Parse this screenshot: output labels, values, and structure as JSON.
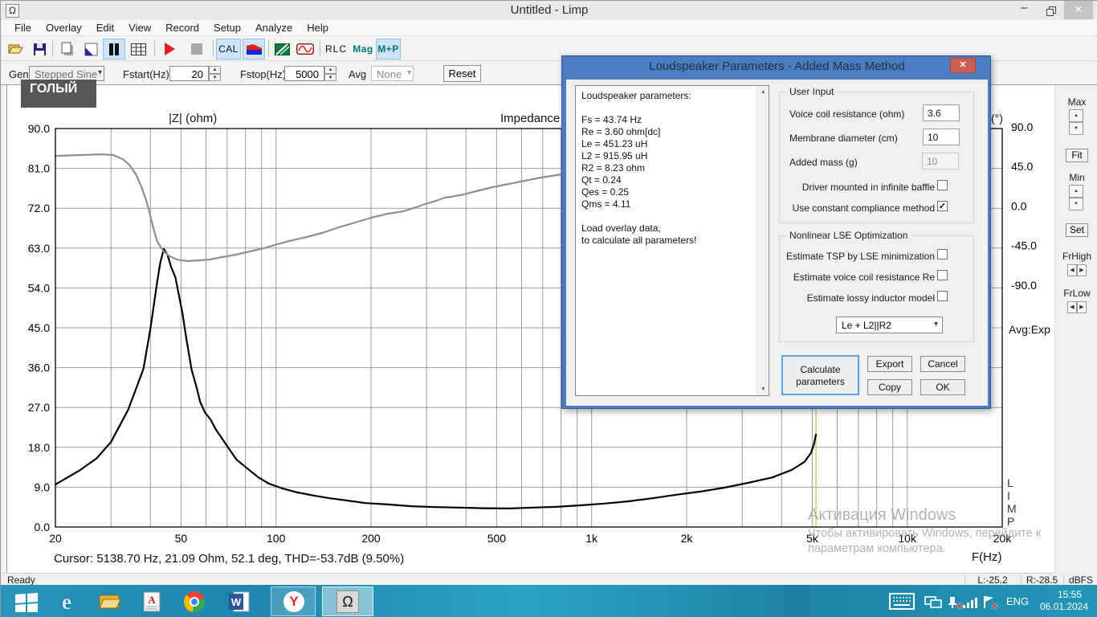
{
  "window": {
    "title": "Untitled - Limp",
    "icon": "Ω"
  },
  "menu": {
    "items": [
      "File",
      "Overlay",
      "Edit",
      "View",
      "Record",
      "Setup",
      "Analyze",
      "Help"
    ]
  },
  "toolbar": {
    "cal": "CAL",
    "rlc": "RLC",
    "mag": "Mag",
    "mp": "M+P"
  },
  "controls": {
    "gen_label": "Gen",
    "gen_value": "Stepped Sine",
    "fstart_label": "Fstart(Hz)",
    "fstart_value": "20",
    "fstop_label": "Fstop(Hz)",
    "fstop_value": "5000",
    "avg_label": "Avg",
    "avg_value": "None",
    "reset": "Reset"
  },
  "tooltip": {
    "text": "ГОЛЫЙ"
  },
  "side_panel": {
    "max": "Max",
    "fit": "Fit",
    "min": "Min",
    "set": "Set",
    "frhigh": "FrHigh",
    "frlow": "FrLow"
  },
  "chart_data": {
    "type": "line",
    "title": "Impedance",
    "y_left_label": "|Z| (ohm)",
    "y_right_label": "(°)",
    "x_label": "F(Hz)",
    "x_scale": "log",
    "x_range": [
      20,
      20000
    ],
    "y_left_range": [
      0,
      90
    ],
    "y_left_ticks": [
      "90.0",
      "81.0",
      "72.0",
      "63.0",
      "54.0",
      "45.0",
      "36.0",
      "27.0",
      "18.0",
      "9.0",
      "0.0"
    ],
    "x_ticks": [
      {
        "f": 20,
        "label": "20"
      },
      {
        "f": 50,
        "label": "50"
      },
      {
        "f": 100,
        "label": "100"
      },
      {
        "f": 200,
        "label": "200"
      },
      {
        "f": 500,
        "label": "500"
      },
      {
        "f": 1000,
        "label": "1k"
      },
      {
        "f": 2000,
        "label": "2k"
      },
      {
        "f": 5000,
        "label": "5k"
      },
      {
        "f": 10000,
        "label": "10k"
      },
      {
        "f": 20000,
        "label": "20k"
      }
    ],
    "grid_freqs": [
      30,
      40,
      50,
      60,
      70,
      80,
      90,
      100,
      200,
      300,
      400,
      500,
      600,
      700,
      800,
      900,
      1000,
      2000,
      3000,
      4000,
      5000,
      6000,
      7000,
      8000,
      9000,
      10000
    ],
    "y_right_ticks": [
      {
        "deg": 90,
        "label": "90.0"
      },
      {
        "deg": 45,
        "label": "45.0"
      },
      {
        "deg": 0,
        "label": "0.0"
      },
      {
        "deg": -45,
        "label": "-45.0"
      },
      {
        "deg": -90,
        "label": "-90.0"
      }
    ],
    "logo_letters": [
      "L",
      "I",
      "M",
      "P"
    ],
    "avg_mode": "Avg:Exp",
    "cursor_hz": 5138.7,
    "cursor_text": "Cursor: 5138.70 Hz, 21.09 Ohm, 52.1 deg, THD=-53.7dB (9.50%)",
    "series": [
      {
        "name": "impedance_magnitude_ohm",
        "color": "#000000",
        "axis": "left",
        "points": [
          [
            20,
            9.6
          ],
          [
            24,
            12.9
          ],
          [
            27,
            15.5
          ],
          [
            30,
            19.2
          ],
          [
            34,
            26.5
          ],
          [
            38,
            35.7
          ],
          [
            40,
            44.8
          ],
          [
            42,
            55.2
          ],
          [
            43,
            59.7
          ],
          [
            44.1,
            62.8
          ],
          [
            45.3,
            61.5
          ],
          [
            46.5,
            58.8
          ],
          [
            48,
            56.4
          ],
          [
            50.5,
            48.4
          ],
          [
            52,
            42.5
          ],
          [
            54,
            35.6
          ],
          [
            56,
            31.6
          ],
          [
            57.5,
            28.3
          ],
          [
            59.5,
            25.9
          ],
          [
            62,
            24.3
          ],
          [
            64.5,
            22.0
          ],
          [
            70,
            18.3
          ],
          [
            75,
            15.2
          ],
          [
            81.5,
            13.1
          ],
          [
            88,
            11.2
          ],
          [
            95,
            9.8
          ],
          [
            105,
            8.7
          ],
          [
            117,
            7.8
          ],
          [
            132,
            7.1
          ],
          [
            148,
            6.5
          ],
          [
            167,
            6.0
          ],
          [
            192,
            5.4
          ],
          [
            226,
            5.1
          ],
          [
            268,
            4.7
          ],
          [
            321,
            4.5
          ],
          [
            382,
            4.4
          ],
          [
            455,
            4.25
          ],
          [
            546,
            4.2
          ],
          [
            650,
            4.4
          ],
          [
            774,
            4.55
          ],
          [
            922,
            4.9
          ],
          [
            1098,
            5.3
          ],
          [
            1308,
            5.8
          ],
          [
            1558,
            6.5
          ],
          [
            1856,
            7.3
          ],
          [
            2210,
            8.0
          ],
          [
            2633,
            8.9
          ],
          [
            3136,
            10.0
          ],
          [
            3735,
            11.2
          ],
          [
            4307,
            12.9
          ],
          [
            4720,
            14.7
          ],
          [
            4950,
            16.7
          ],
          [
            5060,
            18.6
          ],
          [
            5139,
            20.9
          ]
        ]
      },
      {
        "name": "phase_deg",
        "color": "#8f8f8f",
        "axis": "right",
        "points": [
          [
            20,
            57
          ],
          [
            24,
            58
          ],
          [
            28,
            58.8
          ],
          [
            30.5,
            58
          ],
          [
            32.7,
            53.4
          ],
          [
            34.3,
            47
          ],
          [
            36,
            36
          ],
          [
            37.5,
            21.5
          ],
          [
            39,
            4
          ],
          [
            40.8,
            -24
          ],
          [
            42,
            -40
          ],
          [
            44,
            -51.5
          ],
          [
            46,
            -57
          ],
          [
            48.7,
            -61
          ],
          [
            52.6,
            -62.6
          ],
          [
            57.3,
            -61.7
          ],
          [
            61.7,
            -60.8
          ],
          [
            67.4,
            -58
          ],
          [
            74.6,
            -55.3
          ],
          [
            82.6,
            -51.6
          ],
          [
            91.2,
            -48
          ],
          [
            101,
            -43.4
          ],
          [
            110,
            -39.8
          ],
          [
            125,
            -35.2
          ],
          [
            140,
            -30.6
          ],
          [
            158,
            -24.2
          ],
          [
            178,
            -18.7
          ],
          [
            200,
            -13.3
          ],
          [
            226,
            -8.7
          ],
          [
            253,
            -5.9
          ],
          [
            278,
            -1.4
          ],
          [
            297,
            2.3
          ],
          [
            321,
            5.9
          ],
          [
            342,
            9.6
          ],
          [
            358,
            10.5
          ],
          [
            393,
            13.2
          ],
          [
            431,
            16.9
          ],
          [
            485,
            21.5
          ],
          [
            546,
            25.1
          ],
          [
            614,
            28.8
          ],
          [
            691,
            32.4
          ],
          [
            774,
            35.2
          ],
          [
            800,
            36.1
          ]
        ]
      }
    ]
  },
  "dialog": {
    "title": "Loudspeaker Parameters - Added Mass Method",
    "params_text": "Loudspeaker parameters:\n\nFs  = 43.74 Hz\nRe  = 3.60 ohm[dc]\nLe  = 451.23 uH\nL2  = 915.95 uH\nR2  = 8.23 ohm\nQt  = 0.24\nQes = 0.25\nQms = 4.11\n\nLoad overlay data,\nto calculate all parameters!",
    "user_input": {
      "label": "User Input",
      "fields": [
        {
          "label": "Voice coil resistance (ohm)",
          "value": "3.6",
          "disabled": false
        },
        {
          "label": "Membrane diameter (cm)",
          "value": "10",
          "disabled": false
        },
        {
          "label": "Added mass (g)",
          "value": "10",
          "disabled": true
        }
      ],
      "checkboxes": [
        {
          "label": "Driver mounted in infinite baffle",
          "checked": false
        },
        {
          "label": "Use constant compliance method",
          "checked": true
        }
      ]
    },
    "lse": {
      "label": "Nonlinear LSE Optimization",
      "checkboxes": [
        {
          "label": "Estimate TSP by LSE minimization",
          "checked": false
        },
        {
          "label": "Estimate voice coil resistance Re",
          "checked": false
        },
        {
          "label": "Estimate lossy inductor model",
          "checked": false
        }
      ],
      "model": "Le + L2||R2"
    },
    "buttons": {
      "calculate": "Calculate\nparameters",
      "export": "Export",
      "cancel": "Cancel",
      "copy": "Copy",
      "ok": "OK"
    }
  },
  "statusbar": {
    "ready": "Ready",
    "l": "L:-25.2",
    "r": "R:-28.5",
    "unit": "dBFS"
  },
  "taskbar": {
    "lang": "ENG",
    "time": "15:55",
    "date": "06.01.2024"
  },
  "watermark": {
    "line1": "Активация Windows",
    "line2": "Чтобы активировать Windows, перейдите к",
    "line3": "параметрам компьютера."
  }
}
